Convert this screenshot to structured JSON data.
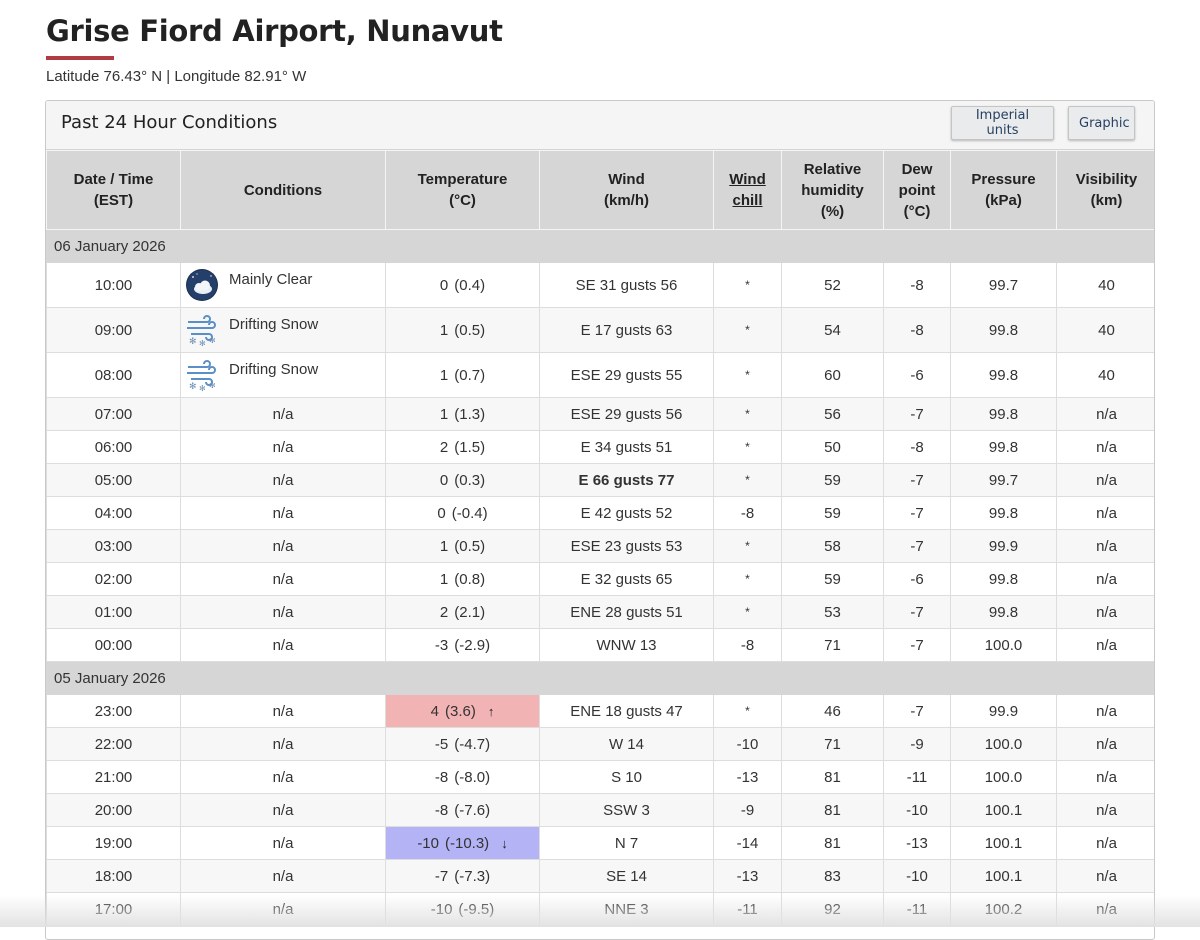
{
  "page": {
    "title": "Grise Fiord Airport, Nunavut",
    "coordinates": "Latitude 76.43° N | Longitude 82.91° W"
  },
  "panel": {
    "title": "Past 24 Hour Conditions",
    "imperial_label": "Imperial units",
    "graphic_label": "Graphic"
  },
  "headers": {
    "datetime": [
      "Date / Time",
      "(EST)"
    ],
    "conditions": "Conditions",
    "temperature": [
      "Temperature",
      "(°C)"
    ],
    "wind": [
      "Wind",
      "(km/h)"
    ],
    "windchill": [
      "Wind",
      "chill"
    ],
    "humidity": [
      "Relative",
      "humidity",
      "(%)"
    ],
    "dewpoint": [
      "Dew",
      "point",
      "(°C)"
    ],
    "pressure": [
      "Pressure",
      "(kPa)"
    ],
    "visibility": [
      "Visibility",
      "(km)"
    ]
  },
  "days": [
    {
      "date": "06 January 2026",
      "rows": [
        {
          "time": "10:00",
          "icon": "mainly-clear-night-icon",
          "cond": "Mainly Clear",
          "temp": "0",
          "temp_raw": "(0.4)",
          "wind": "SE 31 gusts 56",
          "chill": "*",
          "rh": "52",
          "dew": "-8",
          "pres": "99.7",
          "vis": "40"
        },
        {
          "time": "09:00",
          "icon": "drifting-snow-icon",
          "cond": "Drifting Snow",
          "temp": "1",
          "temp_raw": "(0.5)",
          "wind": "E 17 gusts 63",
          "chill": "*",
          "rh": "54",
          "dew": "-8",
          "pres": "99.8",
          "vis": "40"
        },
        {
          "time": "08:00",
          "icon": "drifting-snow-icon",
          "cond": "Drifting Snow",
          "temp": "1",
          "temp_raw": "(0.7)",
          "wind": "ESE 29 gusts 55",
          "chill": "*",
          "rh": "60",
          "dew": "-6",
          "pres": "99.8",
          "vis": "40"
        },
        {
          "time": "07:00",
          "cond": "n/a",
          "temp": "1",
          "temp_raw": "(1.3)",
          "wind": "ESE 29 gusts 56",
          "chill": "*",
          "rh": "56",
          "dew": "-7",
          "pres": "99.8",
          "vis": "n/a"
        },
        {
          "time": "06:00",
          "cond": "n/a",
          "temp": "2",
          "temp_raw": "(1.5)",
          "wind": "E 34 gusts 51",
          "chill": "*",
          "rh": "50",
          "dew": "-8",
          "pres": "99.8",
          "vis": "n/a"
        },
        {
          "time": "05:00",
          "cond": "n/a",
          "temp": "0",
          "temp_raw": "(0.3)",
          "wind": "E 66 gusts 77",
          "wind_bold": true,
          "chill": "*",
          "rh": "59",
          "dew": "-7",
          "pres": "99.7",
          "vis": "n/a"
        },
        {
          "time": "04:00",
          "cond": "n/a",
          "temp": "0",
          "temp_raw": "(-0.4)",
          "wind": "E 42 gusts 52",
          "chill": "-8",
          "rh": "59",
          "dew": "-7",
          "pres": "99.8",
          "vis": "n/a"
        },
        {
          "time": "03:00",
          "cond": "n/a",
          "temp": "1",
          "temp_raw": "(0.5)",
          "wind": "ESE 23 gusts 53",
          "chill": "*",
          "rh": "58",
          "dew": "-7",
          "pres": "99.9",
          "vis": "n/a"
        },
        {
          "time": "02:00",
          "cond": "n/a",
          "temp": "1",
          "temp_raw": "(0.8)",
          "wind": "E 32 gusts 65",
          "chill": "*",
          "rh": "59",
          "dew": "-6",
          "pres": "99.8",
          "vis": "n/a"
        },
        {
          "time": "01:00",
          "cond": "n/a",
          "temp": "2",
          "temp_raw": "(2.1)",
          "wind": "ENE 28 gusts 51",
          "chill": "*",
          "rh": "53",
          "dew": "-7",
          "pres": "99.8",
          "vis": "n/a"
        },
        {
          "time": "00:00",
          "cond": "n/a",
          "temp": "-3",
          "temp_raw": "(-2.9)",
          "wind": "WNW 13",
          "chill": "-8",
          "rh": "71",
          "dew": "-7",
          "pres": "100.0",
          "vis": "n/a"
        }
      ]
    },
    {
      "date": "05 January 2026",
      "rows": [
        {
          "time": "23:00",
          "cond": "n/a",
          "temp": "4",
          "temp_raw": "(3.6)",
          "extreme": "high",
          "arrow": "↑",
          "wind": "ENE 18 gusts 47",
          "chill": "*",
          "rh": "46",
          "dew": "-7",
          "pres": "99.9",
          "vis": "n/a"
        },
        {
          "time": "22:00",
          "cond": "n/a",
          "temp": "-5",
          "temp_raw": "(-4.7)",
          "wind": "W 14",
          "chill": "-10",
          "rh": "71",
          "dew": "-9",
          "pres": "100.0",
          "vis": "n/a"
        },
        {
          "time": "21:00",
          "cond": "n/a",
          "temp": "-8",
          "temp_raw": "(-8.0)",
          "wind": "S 10",
          "chill": "-13",
          "rh": "81",
          "dew": "-11",
          "pres": "100.0",
          "vis": "n/a"
        },
        {
          "time": "20:00",
          "cond": "n/a",
          "temp": "-8",
          "temp_raw": "(-7.6)",
          "wind": "SSW 3",
          "chill": "-9",
          "rh": "81",
          "dew": "-10",
          "pres": "100.1",
          "vis": "n/a"
        },
        {
          "time": "19:00",
          "cond": "n/a",
          "temp": "-10",
          "temp_raw": "(-10.3)",
          "extreme": "low",
          "arrow": "↓",
          "wind": "N 7",
          "chill": "-14",
          "rh": "81",
          "dew": "-13",
          "pres": "100.1",
          "vis": "n/a"
        },
        {
          "time": "18:00",
          "cond": "n/a",
          "temp": "-7",
          "temp_raw": "(-7.3)",
          "wind": "SE 14",
          "chill": "-13",
          "rh": "83",
          "dew": "-10",
          "pres": "100.1",
          "vis": "n/a"
        },
        {
          "time": "17:00",
          "cond": "n/a",
          "temp": "-10",
          "temp_raw": "(-9.5)",
          "wind": "NNE 3",
          "chill": "-11",
          "rh": "92",
          "dew": "-11",
          "pres": "100.2",
          "vis": "n/a"
        }
      ]
    }
  ]
}
